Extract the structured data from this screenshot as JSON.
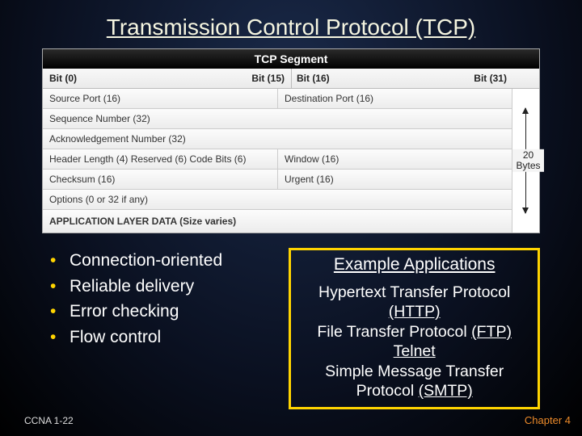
{
  "title": "Transmission Control Protocol (TCP)",
  "diagram": {
    "caption": "TCP Segment",
    "bit_labels": {
      "b0": "Bit (0)",
      "b15": "Bit (15)",
      "b16": "Bit (16)",
      "b31": "Bit (31)"
    },
    "rows": {
      "src_port": "Source Port (16)",
      "dst_port": "Destination Port (16)",
      "seq_num": "Sequence Number (32)",
      "ack_num": "Acknowledgement Number (32)",
      "hlen_res_code": "Header Length (4) Reserved (6) Code Bits (6)",
      "window": "Window (16)",
      "checksum": "Checksum (16)",
      "urgent": "Urgent (16)",
      "options": "Options (0 or 32 if any)",
      "appdata": "APPLICATION LAYER DATA (Size varies)"
    },
    "bytes_label": "20 Bytes"
  },
  "bullets": [
    "Connection-oriented",
    "Reliable delivery",
    "Error checking",
    "Flow control"
  ],
  "panel": {
    "title": "Example Applications",
    "line1a": "Hypertext Transfer Protocol ",
    "line1b": "(HTTP)",
    "line2a": "File Transfer Protocol ",
    "line2b": "(FTP)",
    "line3": "Telnet",
    "line4a": "Simple Message Transfer Protocol ",
    "line4b": "(SMTP)"
  },
  "footer": {
    "left": "CCNA 1-22",
    "right": "Chapter 4"
  }
}
